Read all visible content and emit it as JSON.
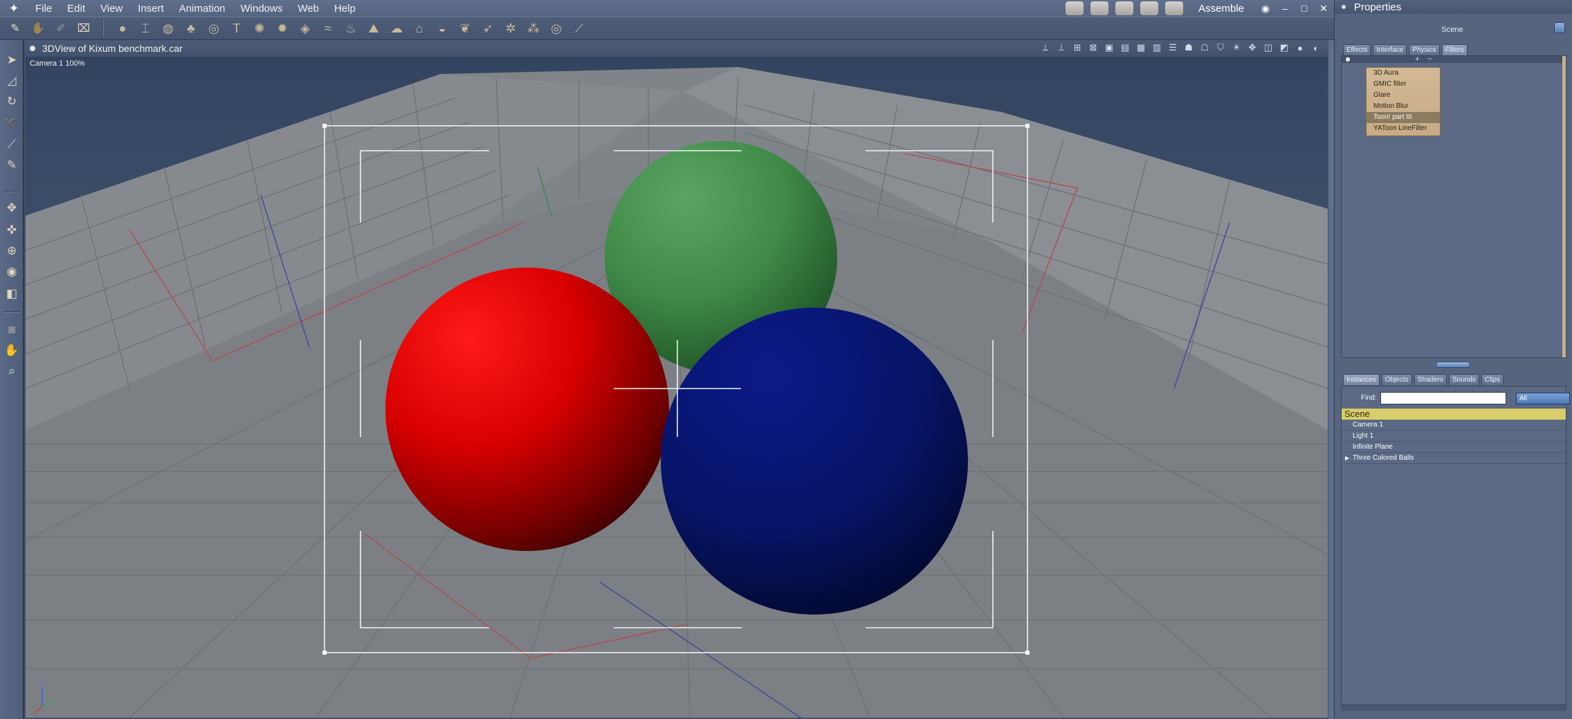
{
  "menubar": {
    "items": [
      "File",
      "Edit",
      "View",
      "Insert",
      "Animation",
      "Windows",
      "Web",
      "Help"
    ],
    "room_label": "Assemble"
  },
  "viewport": {
    "title": "3DView of Kixum benchmark.car",
    "camera_label": "Camera 1 100%"
  },
  "scene": {
    "colors": {
      "red_ball": "#ff1010",
      "green_ball": "#4f9a55",
      "blue_ball": "#0a1470",
      "floor": "#818589",
      "wall": "#8b8f94",
      "backdrop": "#2f3f5a"
    }
  },
  "properties": {
    "title": "Properties",
    "header": "Scene",
    "top_tabs": [
      "Effects",
      "Interface",
      "Physics",
      "Filters"
    ],
    "active_top_tab": "Filters",
    "filters": [
      "3D Aura",
      "GMIC filter",
      "Glare",
      "Motion Blur",
      "Toon! part III",
      "YAToon LineFilter"
    ],
    "selected_filter": "Toon! part III",
    "bottom_tabs": [
      "Instances",
      "Objects",
      "Shaders",
      "Sounds",
      "Clips"
    ],
    "active_bottom_tab": "Instances",
    "find_label": "Find:",
    "find_value": "",
    "find_select": "All",
    "tree_root": "Scene",
    "tree_items": [
      "Camera 1",
      "Light 1",
      "Infinite Plane",
      "Three Colored Balls"
    ]
  }
}
